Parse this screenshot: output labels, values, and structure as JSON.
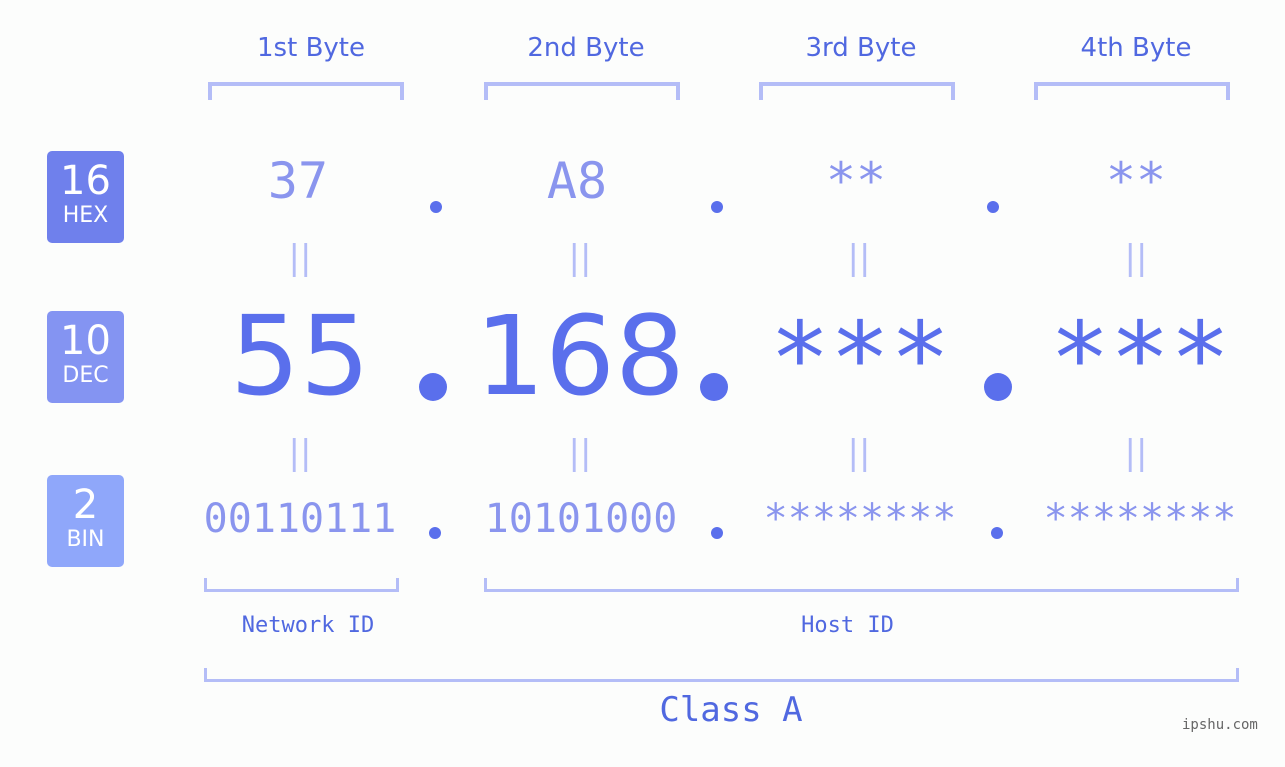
{
  "byte_headers": [
    "1st Byte",
    "2nd Byte",
    "3rd Byte",
    "4th Byte"
  ],
  "badges": [
    {
      "base": "16",
      "label": "HEX",
      "color": "#6f80ec"
    },
    {
      "base": "10",
      "label": "DEC",
      "color": "#8494f2"
    },
    {
      "base": "2",
      "label": "BIN",
      "color": "#8fa7fa"
    }
  ],
  "hex": [
    "37",
    "A8",
    "**",
    "**"
  ],
  "dec": [
    "55",
    "168",
    "***",
    "***"
  ],
  "bin": [
    "00110111",
    "10101000",
    "********",
    "********"
  ],
  "equals_symbol": "||",
  "separator": ".",
  "network_label": "Network ID",
  "host_label": "Host ID",
  "class_label": "Class A",
  "watermark": "ipshu.com",
  "colors": {
    "primary": "#5a6fec",
    "light": "#8a95ee",
    "bracket": "#b4bdf7",
    "text": "#5068e0"
  }
}
